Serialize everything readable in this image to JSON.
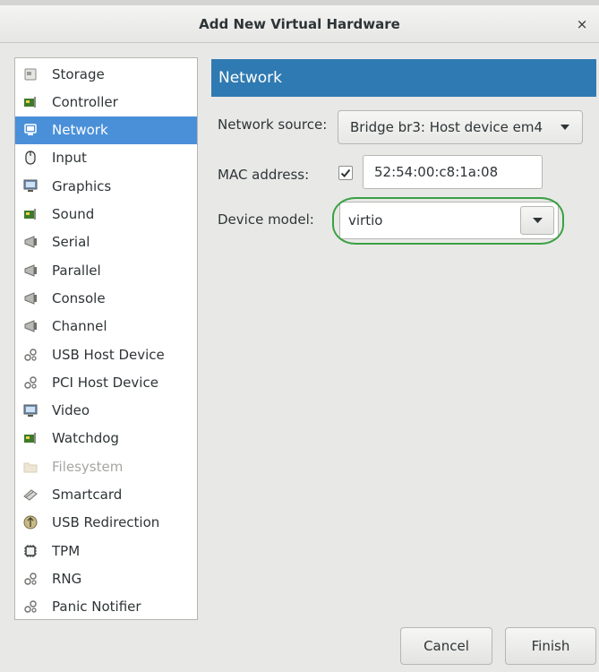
{
  "window": {
    "title": "Add New Virtual Hardware",
    "close_glyph": "×"
  },
  "sidebar": {
    "selected_color": "#4a90d9",
    "items": [
      {
        "label": "Storage",
        "icon": "storage-icon"
      },
      {
        "label": "Controller",
        "icon": "controller-icon"
      },
      {
        "label": "Network",
        "icon": "network-icon",
        "selected": true
      },
      {
        "label": "Input",
        "icon": "mouse-icon"
      },
      {
        "label": "Graphics",
        "icon": "monitor-icon"
      },
      {
        "label": "Sound",
        "icon": "sound-card-icon"
      },
      {
        "label": "Serial",
        "icon": "serial-port-icon"
      },
      {
        "label": "Parallel",
        "icon": "parallel-port-icon"
      },
      {
        "label": "Console",
        "icon": "console-port-icon"
      },
      {
        "label": "Channel",
        "icon": "channel-port-icon"
      },
      {
        "label": "USB Host Device",
        "icon": "usb-device-icon"
      },
      {
        "label": "PCI Host Device",
        "icon": "pci-device-icon"
      },
      {
        "label": "Video",
        "icon": "video-icon"
      },
      {
        "label": "Watchdog",
        "icon": "watchdog-icon"
      },
      {
        "label": "Filesystem",
        "icon": "folder-icon",
        "disabled": true
      },
      {
        "label": "Smartcard",
        "icon": "smartcard-icon"
      },
      {
        "label": "USB Redirection",
        "icon": "usb-redirection-icon"
      },
      {
        "label": "TPM",
        "icon": "tpm-chip-icon"
      },
      {
        "label": "RNG",
        "icon": "rng-icon"
      },
      {
        "label": "Panic Notifier",
        "icon": "panic-notifier-icon"
      }
    ]
  },
  "panel": {
    "header": "Network",
    "header_color": "#2f7ab2",
    "network_source": {
      "label": "Network source:",
      "value": "Bridge br3: Host device em4"
    },
    "mac": {
      "label": "MAC address:",
      "checked": true,
      "value": "52:54:00:c8:1a:08"
    },
    "device_model": {
      "label": "Device model:",
      "value": "virtio",
      "highlight_color": "#3aa142"
    }
  },
  "footer": {
    "cancel": "Cancel",
    "finish": "Finish"
  }
}
